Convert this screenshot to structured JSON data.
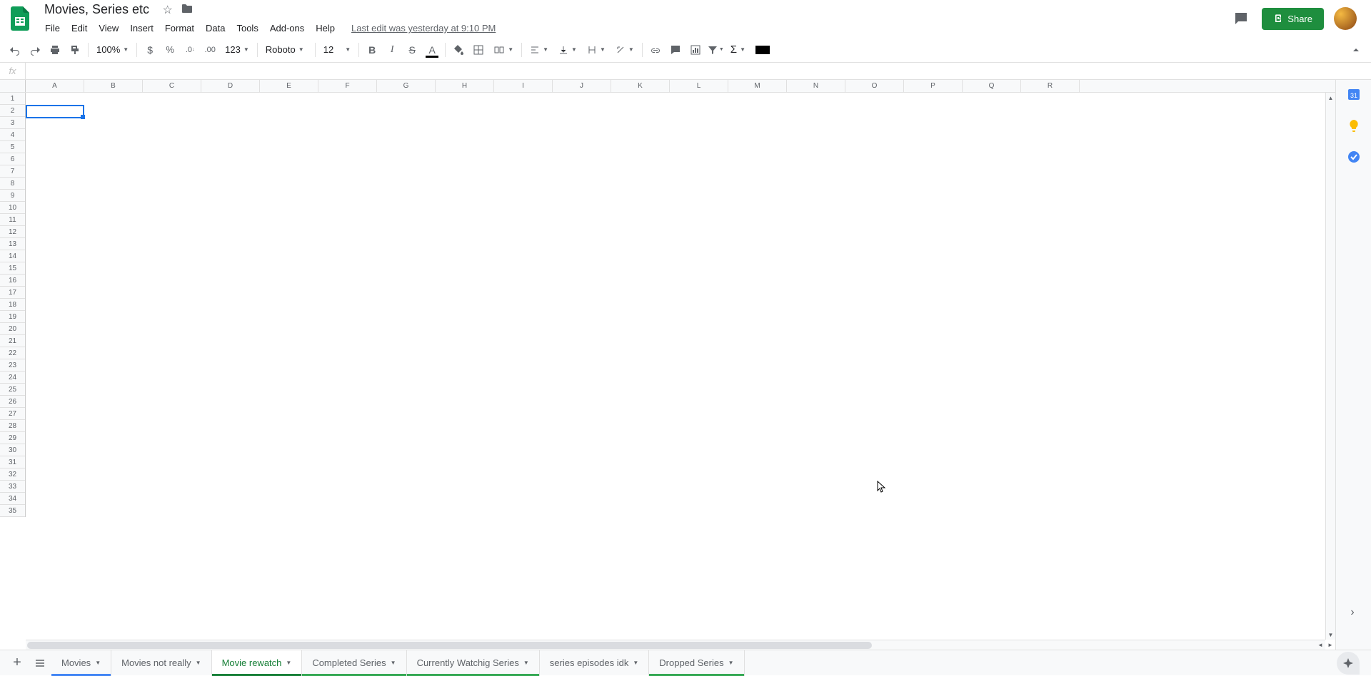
{
  "doc": {
    "title": "Movies, Series etc",
    "last_edit": "Last edit was yesterday at 9:10 PM"
  },
  "menu": {
    "file": "File",
    "edit": "Edit",
    "view": "View",
    "insert": "Insert",
    "format": "Format",
    "data": "Data",
    "tools": "Tools",
    "addons": "Add-ons",
    "help": "Help"
  },
  "toolbar": {
    "zoom": "100%",
    "format_123": "123",
    "font": "Roboto",
    "font_size": "12",
    "decrease_decimal": ".0",
    "increase_decimal": ".00"
  },
  "share": {
    "label": "Share"
  },
  "formula_bar": {
    "fx": "fx",
    "value": ""
  },
  "columns": [
    "A",
    "B",
    "C",
    "D",
    "E",
    "F",
    "G",
    "H",
    "I",
    "J",
    "K",
    "L",
    "M",
    "N",
    "O",
    "P",
    "Q",
    "R"
  ],
  "rows": [
    "1",
    "2",
    "3",
    "4",
    "5",
    "6",
    "7",
    "8",
    "9",
    "10",
    "11",
    "12",
    "13",
    "14",
    "15",
    "16",
    "17",
    "18",
    "19",
    "20",
    "21",
    "22",
    "23",
    "24",
    "25",
    "26",
    "27",
    "28",
    "29",
    "30",
    "31",
    "32",
    "33",
    "34",
    "35"
  ],
  "selected_cell": "A2",
  "sheets": [
    {
      "name": "Movies",
      "class": "movies"
    },
    {
      "name": "Movies not really",
      "class": ""
    },
    {
      "name": "Movie rewatch",
      "class": "active"
    },
    {
      "name": "Completed Series",
      "class": "green-underline"
    },
    {
      "name": "Currently Watchig Series",
      "class": "green-underline"
    },
    {
      "name": "series episodes idk",
      "class": ""
    },
    {
      "name": "Dropped Series",
      "class": "green-underline"
    }
  ]
}
